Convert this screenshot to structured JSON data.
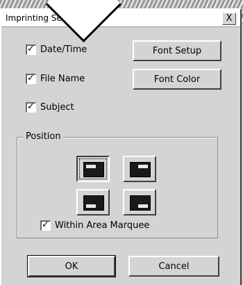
{
  "dialog": {
    "title": "Imprinting Setup",
    "close_glyph": "X"
  },
  "checkboxes": [
    {
      "label": "Date/Time",
      "checked": true
    },
    {
      "label": "File Name",
      "checked": true
    },
    {
      "label": "Subject",
      "checked": true
    }
  ],
  "check_glyph": "✓",
  "buttons": {
    "font_setup": "Font Setup",
    "font_color": "Font Color",
    "ok": "OK",
    "cancel": "Cancel"
  },
  "position": {
    "legend": "Position",
    "options": [
      "top-left",
      "top-right",
      "bottom-left",
      "bottom-right"
    ],
    "selected": "top-left",
    "within_area_marquee_label": "Within Area Marquee",
    "within_area_marquee_checked": true
  }
}
